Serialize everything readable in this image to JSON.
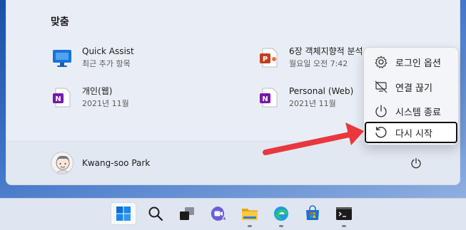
{
  "start_menu": {
    "section_title": "맞춤",
    "recommended": [
      {
        "name": "Quick Assist",
        "subtitle": "최근 추가 항목",
        "icon": "quick-assist-icon"
      },
      {
        "name": "6장 객체지향적 분석 …",
        "subtitle": "월요일 오전 7:42",
        "icon": "powerpoint-file-icon"
      },
      {
        "name": "개인(웹)",
        "subtitle": "2021년 11월",
        "icon": "onenote-icon"
      },
      {
        "name": "Personal (Web)",
        "subtitle": "2021년 11월",
        "icon": "onenote-icon"
      }
    ],
    "user": {
      "name": "Kwang-soo Park"
    }
  },
  "power_menu": {
    "items": [
      {
        "label": "로그인 옵션",
        "icon": "gear-icon"
      },
      {
        "label": "연결 끊기",
        "icon": "disconnect-icon"
      },
      {
        "label": "시스템 종료",
        "icon": "power-icon"
      },
      {
        "label": "다시 시작",
        "icon": "restart-icon",
        "selected": true
      }
    ]
  },
  "taskbar": {
    "icons": [
      "windows-start-icon",
      "search-icon",
      "task-view-icon",
      "teams-chat-icon",
      "file-explorer-icon",
      "edge-browser-icon",
      "microsoft-store-icon",
      "terminal-icon"
    ]
  },
  "colors": {
    "accent_arrow": "#e8383d",
    "menu_bg": "#e9eef6",
    "taskbar_bg": "#dfe6f1"
  }
}
